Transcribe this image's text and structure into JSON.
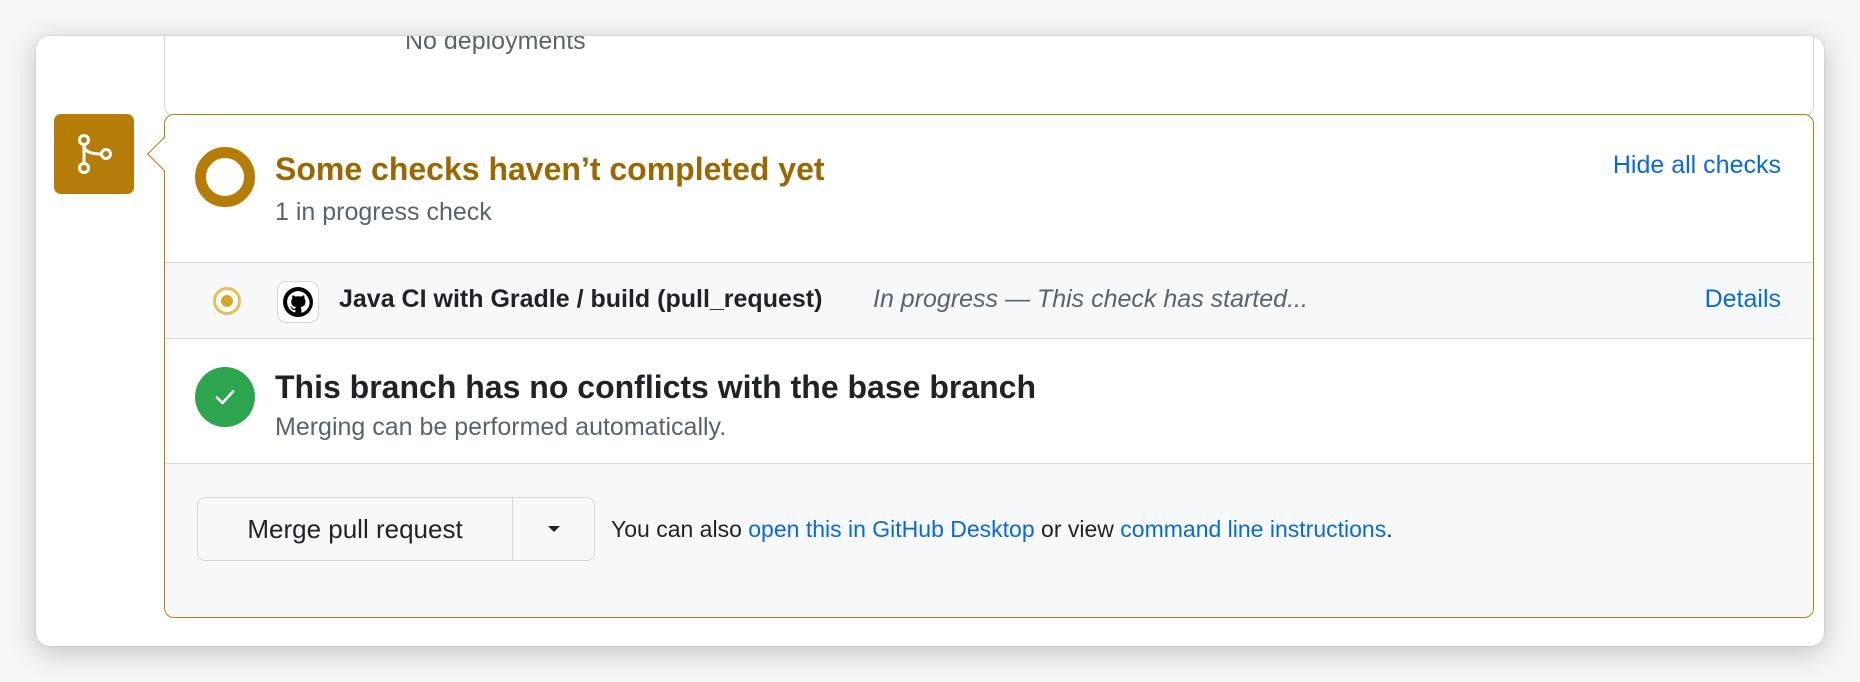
{
  "deployments": {
    "text": "No deployments"
  },
  "checks": {
    "title": "Some checks haven’t completed yet",
    "subtitle": "1 in progress check",
    "toggle_label": "Hide all checks",
    "items": [
      {
        "icon": "github-icon",
        "name": "Java CI with Gradle / build (pull_request)",
        "status": "In progress — This check has started...",
        "details_label": "Details"
      }
    ]
  },
  "conflicts": {
    "title": "This branch has no conflicts with the base branch",
    "subtitle": "Merging can be performed automatically."
  },
  "merge": {
    "button_label": "Merge pull request",
    "hint_prefix": "You can also ",
    "desktop_link": "open this in GitHub Desktop",
    "hint_middle": " or view ",
    "cli_link": "command line instructions",
    "hint_suffix": "."
  },
  "colors": {
    "pending": "#b57c07",
    "pending_text": "#9a6700",
    "success": "#2da44e",
    "link": "#0969da"
  }
}
